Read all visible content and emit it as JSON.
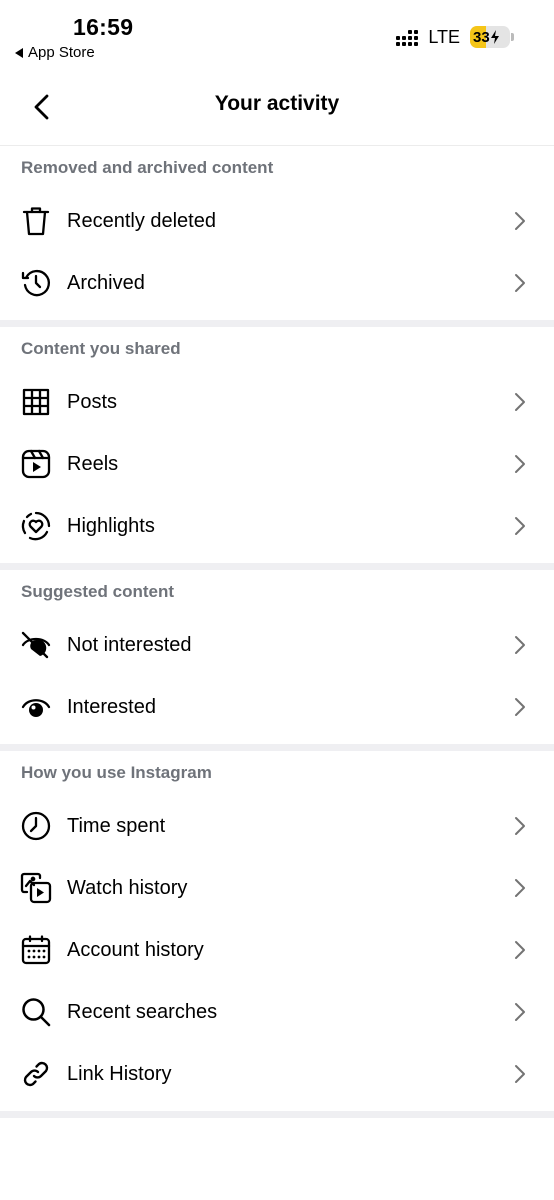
{
  "status": {
    "time": "16:59",
    "back_app": "App Store",
    "network": "LTE",
    "battery": "33"
  },
  "header": {
    "title": "Your activity"
  },
  "sections": [
    {
      "title": "Removed and archived content",
      "items": [
        {
          "label": "Recently deleted",
          "icon": "trash-icon"
        },
        {
          "label": "Archived",
          "icon": "archive-clock-icon"
        }
      ]
    },
    {
      "title": "Content you shared",
      "items": [
        {
          "label": "Posts",
          "icon": "grid-icon"
        },
        {
          "label": "Reels",
          "icon": "reels-icon"
        },
        {
          "label": "Highlights",
          "icon": "highlights-icon"
        }
      ]
    },
    {
      "title": "Suggested content",
      "items": [
        {
          "label": "Not interested",
          "icon": "eye-off-icon"
        },
        {
          "label": "Interested",
          "icon": "eye-icon"
        }
      ]
    },
    {
      "title": "How you use Instagram",
      "items": [
        {
          "label": "Time spent",
          "icon": "clock-icon"
        },
        {
          "label": "Watch history",
          "icon": "watch-history-icon"
        },
        {
          "label": "Account history",
          "icon": "calendar-icon"
        },
        {
          "label": "Recent searches",
          "icon": "search-icon"
        },
        {
          "label": "Link History",
          "icon": "link-icon"
        }
      ]
    }
  ]
}
